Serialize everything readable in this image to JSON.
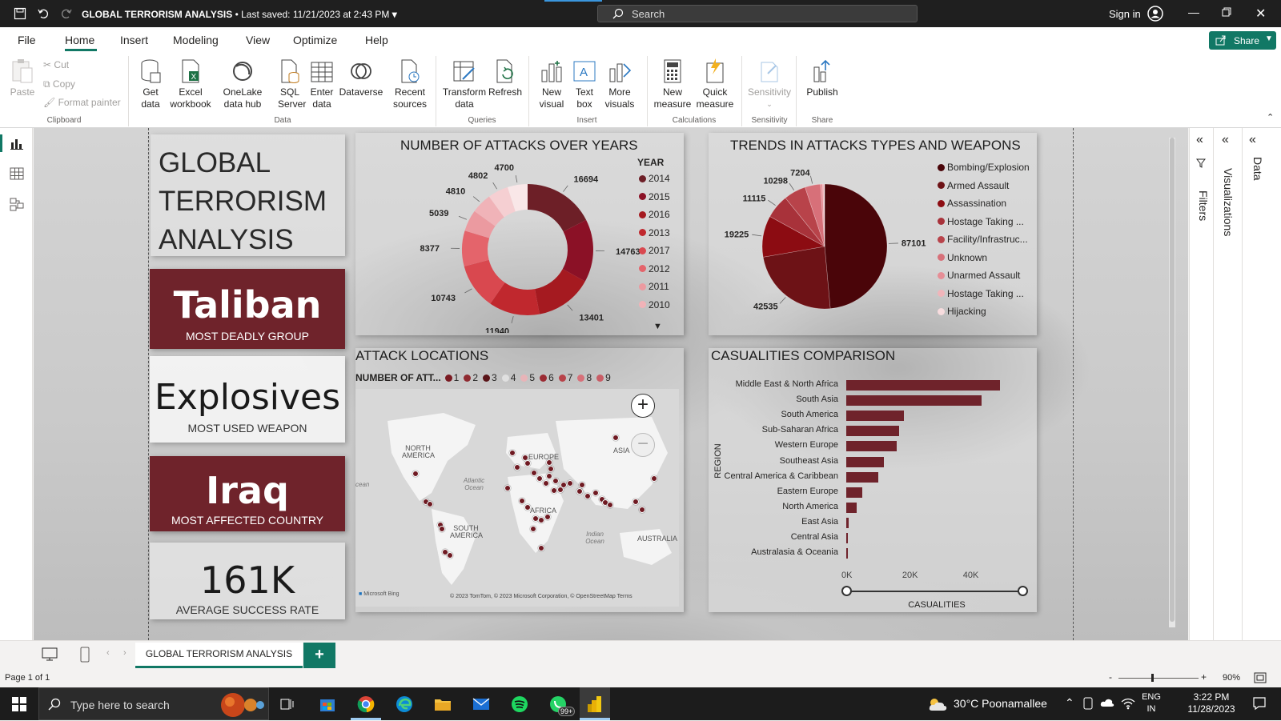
{
  "window": {
    "doc_title": "GLOBAL TERRORISM ANALYSIS",
    "saved_status": "• Last saved: 11/21/2023 at 2:43 PM",
    "search_placeholder": "Search",
    "sign_in": "Sign in"
  },
  "menu": {
    "items": [
      "File",
      "Home",
      "Insert",
      "Modeling",
      "View",
      "Optimize",
      "Help"
    ],
    "active": "Home",
    "share_label": "Share"
  },
  "ribbon": {
    "clipboard": {
      "paste": "Paste",
      "cut": "Cut",
      "copy": "Copy",
      "format_painter": "Format painter",
      "group": "Clipboard"
    },
    "data": {
      "get_data": "Get data",
      "excel": "Excel workbook",
      "onelake": "OneLake data hub",
      "sql": "SQL Server",
      "enter": "Enter data",
      "dataverse": "Dataverse",
      "recent": "Recent sources",
      "group": "Data"
    },
    "queries": {
      "transform": "Transform data",
      "refresh": "Refresh",
      "group": "Queries"
    },
    "insert": {
      "new_visual": "New visual",
      "text_box": "Text box",
      "more_visuals": "More visuals",
      "group": "Insert"
    },
    "calculations": {
      "new_measure": "New measure",
      "quick_measure": "Quick measure",
      "group": "Calculations"
    },
    "sensitivity": {
      "label": "Sensitivity",
      "group": "Sensitivity"
    },
    "share": {
      "publish": "Publish",
      "group": "Share"
    }
  },
  "right_panes": {
    "filters": "Filters",
    "visualizations": "Visualizations",
    "data": "Data"
  },
  "report": {
    "title_lines": [
      "GLOBAL",
      "TERRORISM",
      "ANALYSIS"
    ],
    "kpis": [
      {
        "value": "Taliban",
        "label": "MOST DEADLY GROUP"
      },
      {
        "value": "Explosives",
        "label": "MOST USED WEAPON"
      },
      {
        "value": "Iraq",
        "label": "MOST AFFECTED COUNTRY"
      },
      {
        "value": "161K",
        "label": "AVERAGE SUCCESS RATE"
      }
    ],
    "donut_title": "NUMBER OF ATTACKS OVER YEARS",
    "pie_title": "TRENDS IN ATTACKS TYPES AND WEAPONS",
    "map_title": "ATTACK LOCATIONS",
    "map_legend_label": "NUMBER OF ATT...",
    "map_legend_values": [
      "1",
      "2",
      "3",
      "4",
      "5",
      "6",
      "7",
      "8",
      "9"
    ],
    "map_labels": {
      "north_america": "NORTH AMERICA",
      "south_america": "SOUTH AMERICA",
      "europe": "EUROPE",
      "africa": "AFRICA",
      "asia": "ASIA",
      "australia": "AUSTRALIA",
      "atlantic": "Atlantic Ocean",
      "indian": "Indian Ocean",
      "ocean": "cean"
    },
    "map_attribution": "© 2023 TomTom, © 2023 Microsoft Corporation, © OpenStreetMap  Terms",
    "map_bing": "Microsoft Bing",
    "bar_title": "CASUALITIES COMPARISON"
  },
  "chart_data": [
    {
      "type": "pie",
      "variant": "donut",
      "title": "NUMBER OF ATTACKS OVER YEARS",
      "legend_title": "YEAR",
      "legend_position": "right",
      "categories": [
        "2014",
        "2015",
        "2016",
        "2013",
        "2017",
        "2012",
        "2011",
        "2010",
        "",
        ""
      ],
      "values": [
        16694,
        14763,
        13401,
        11940,
        10743,
        8377,
        5039,
        4810,
        4802,
        4700
      ],
      "colors": [
        "#6d1f27",
        "#8b1126",
        "#a51a20",
        "#c0282e",
        "#d9484f",
        "#e4646b",
        "#eb9aa0",
        "#f0b3b8",
        "#f5cfd2",
        "#f9e7e8"
      ]
    },
    {
      "type": "pie",
      "title": "TRENDS IN ATTACKS TYPES AND WEAPONS",
      "legend_position": "right",
      "categories": [
        "Bombing/Explosion",
        "Armed Assault",
        "Assassination",
        "Hostage Taking ...",
        "Facility/Infrastruc...",
        "Unknown",
        "Unarmed Assault",
        "Hostage Taking ...",
        "Hijacking"
      ],
      "values": [
        87101,
        42535,
        19225,
        11115,
        10298,
        7204,
        1000,
        600,
        300
      ],
      "data_labels": [
        "87101",
        "42535",
        "19225",
        "11115",
        "10298",
        "7204",
        "",
        "",
        ""
      ],
      "colors": [
        "#4a0509",
        "#6d1216",
        "#8c0c12",
        "#a8323a",
        "#b8434a",
        "#d77079",
        "#e68e96",
        "#f0b5ba",
        "#f7dcde"
      ]
    },
    {
      "type": "bar",
      "orientation": "horizontal",
      "title": "CASUALITIES COMPARISON",
      "xlabel": "CASUALITIES",
      "ylabel": "REGION",
      "categories": [
        "Middle East & North Africa",
        "South Asia",
        "South America",
        "Sub-Saharan Africa",
        "Western Europe",
        "Southeast Asia",
        "Central America & Caribbean",
        "Eastern Europe",
        "North America",
        "East Asia",
        "Central Asia",
        "Australasia & Oceania"
      ],
      "values": [
        50500,
        44500,
        19000,
        17500,
        16500,
        12500,
        10500,
        5200,
        3500,
        900,
        500,
        200
      ],
      "xlim": [
        0,
        58000
      ],
      "x_ticks": [
        "0K",
        "20K",
        "40K"
      ],
      "color": "#6f232b"
    }
  ],
  "page_tabs": {
    "active": "GLOBAL TERRORISM ANALYSIS",
    "add": "+"
  },
  "status": {
    "page": "Page 1 of 1",
    "zoom": "90%"
  },
  "taskbar": {
    "search_placeholder": "Type here to search",
    "weather": "30°C  Poonamallee",
    "lang_top": "ENG",
    "lang_bottom": "IN",
    "time": "3:22 PM",
    "date": "11/28/2023",
    "whatsapp_badge": "99+"
  }
}
